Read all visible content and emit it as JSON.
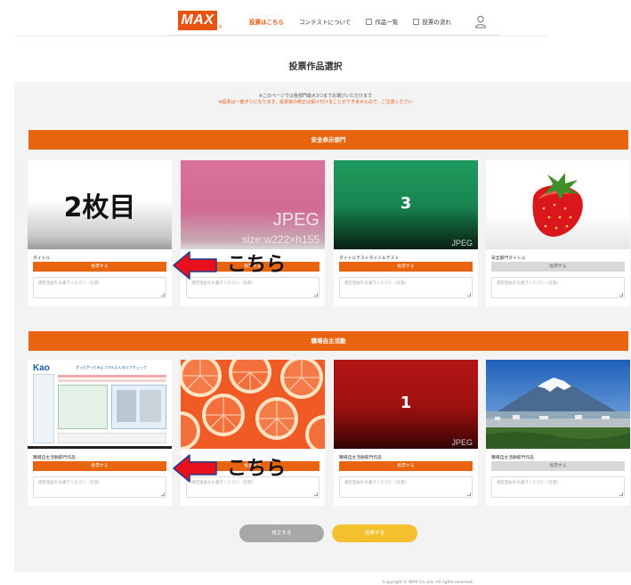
{
  "header": {
    "logo": "MAX",
    "logo_mark": "®",
    "nav": [
      {
        "label": "投票はこちら",
        "active": true,
        "icon": ""
      },
      {
        "label": "コンテストについて",
        "active": false,
        "icon": ""
      },
      {
        "label": "作品一覧",
        "active": false,
        "icon": "document-icon"
      },
      {
        "label": "投票の流れ",
        "active": false,
        "icon": "edit-icon"
      }
    ],
    "user_icon": "user-icon"
  },
  "page_title": "投票作品選択",
  "notice": {
    "line1": "※このページでは各部門最大3つまでお選びいただけます",
    "line2": "※投票は一度きりになります。投票後の修正は受け付けることができませんので、ご注意ください"
  },
  "sections": [
    {
      "title": "安全表示部門",
      "cards": [
        {
          "image_text": "2枚目",
          "title": "タイトル",
          "vote_label": "投票する",
          "vote_enabled": true,
          "reason_placeholder": "選定理由をお書きください（任意）"
        },
        {
          "image_text": "JPEG",
          "image_subtext": "size:w222×h155",
          "title": "",
          "vote_label": "投票する",
          "vote_enabled": true,
          "reason_placeholder": "選定理由をお書きください（任意）"
        },
        {
          "image_text": "3",
          "image_subtext": "JPEG",
          "title": "タイトルテストタイトルテスト",
          "vote_label": "投票する",
          "vote_enabled": true,
          "reason_placeholder": "選定理由をお書きください（任意）"
        },
        {
          "image_text": "",
          "title": "安全部門タイトル",
          "vote_label": "投票する",
          "vote_enabled": false,
          "reason_placeholder": "選定理由をお書きください（任意）"
        }
      ]
    },
    {
      "title": "職場自主活動",
      "cards": [
        {
          "image_text": "Kao",
          "image_subtext": "ずっとやってみようかんたんセルフチェック",
          "title": "職場自主活動部門作品",
          "vote_label": "投票する",
          "vote_enabled": true,
          "reason_placeholder": "選定理由をお書きください（任意）"
        },
        {
          "image_text": "",
          "title": "",
          "vote_label": "投票する",
          "vote_enabled": true,
          "reason_placeholder": "選定理由をお書きください（任意）"
        },
        {
          "image_text": "1",
          "image_subtext": "JPEG",
          "title": "職場自主活動部門作品",
          "vote_label": "投票する",
          "vote_enabled": true,
          "reason_placeholder": "選定理由をお書きください（任意）"
        },
        {
          "image_text": "",
          "title": "職場自主活動部門作品",
          "vote_label": "投票する",
          "vote_enabled": false,
          "reason_placeholder": "選定理由をお書きください（任意）"
        }
      ]
    }
  ],
  "annotation": {
    "label": "こちら"
  },
  "actions": {
    "fix_label": "修正する",
    "submit_label": "投票する"
  },
  "footer": {
    "copyright": "Copyright © MAX Co.,Ltd. All rights reserved."
  },
  "colors": {
    "accent": "#e8640f",
    "submit": "#f5c02e",
    "fix": "#a8a8a8",
    "arrow": "#e8111b"
  }
}
